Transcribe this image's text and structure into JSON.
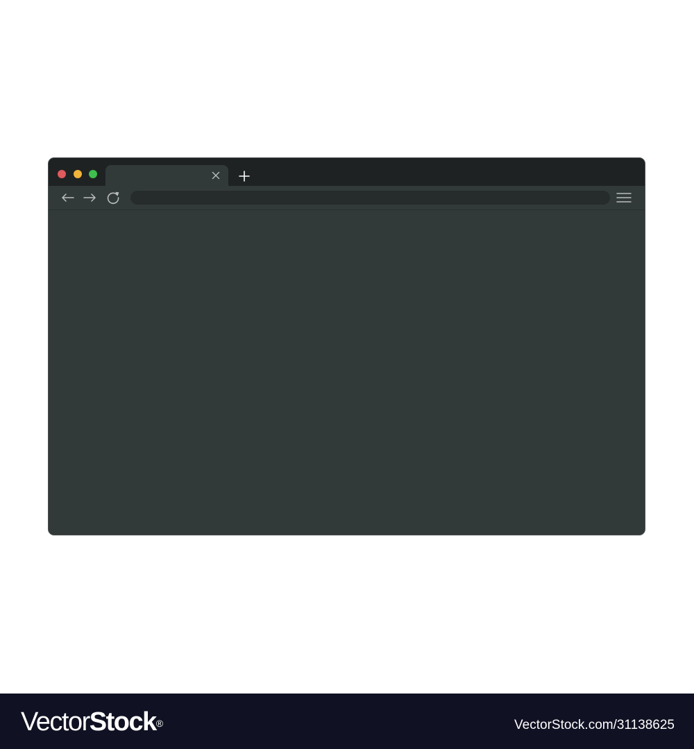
{
  "browser": {
    "colors": {
      "titlebar": "#1f2222",
      "window": "#323a39",
      "address_bar": "#262b2b",
      "icon": "#b9bebd",
      "traffic_close": "#e05a5e",
      "traffic_minimize": "#f2b33a",
      "traffic_maximize": "#3fbf4f"
    },
    "window_controls": [
      "close",
      "minimize",
      "maximize"
    ],
    "tab": {
      "label": "",
      "close_icon": "x-icon"
    },
    "new_tab_icon": "plus-icon",
    "toolbar": {
      "back_icon": "arrow-left-icon",
      "forward_icon": "arrow-right-icon",
      "reload_icon": "reload-icon",
      "address_value": "",
      "address_placeholder": "",
      "menu_icon": "hamburger-icon"
    }
  },
  "watermark": {
    "logo_light": "Vector",
    "logo_bold": "Stock",
    "logo_reg": "®",
    "id_text": "VectorStock.com/31138625",
    "background": "#101223"
  }
}
